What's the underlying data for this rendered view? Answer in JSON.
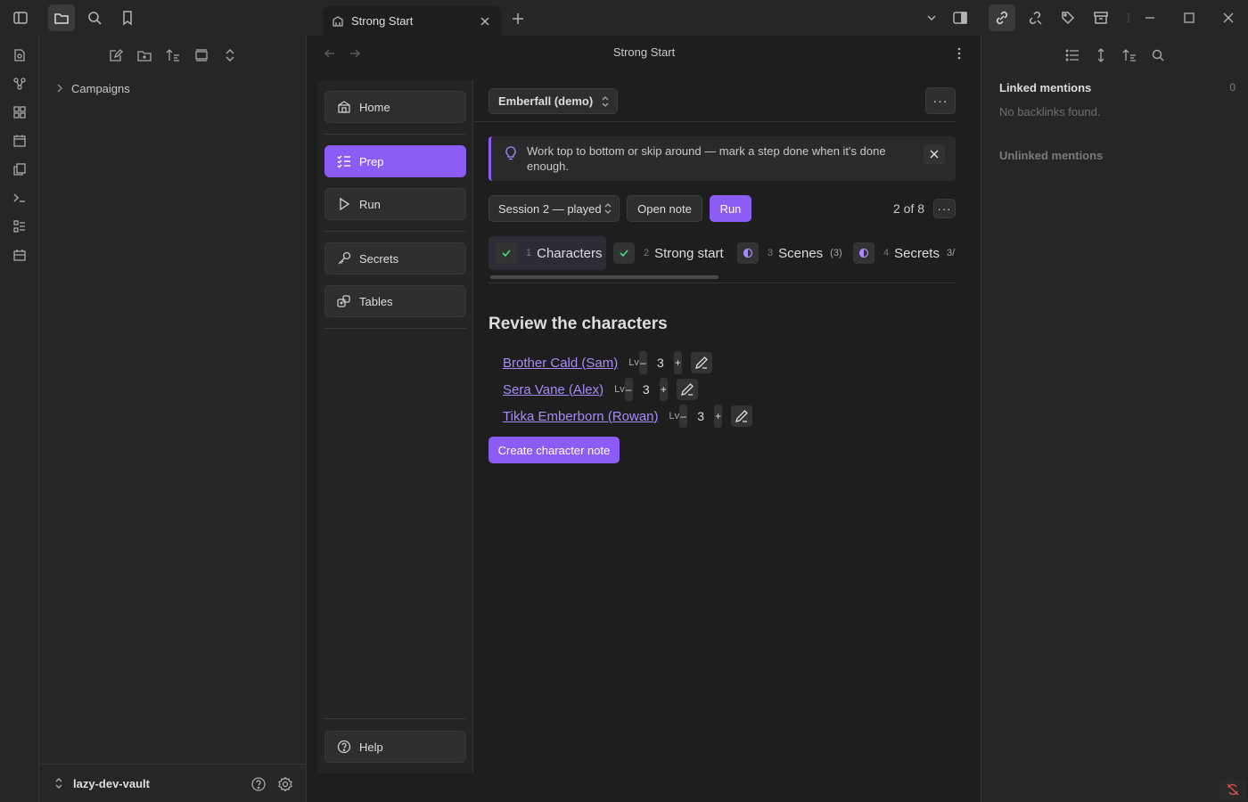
{
  "titlebar": {
    "tab_title": "Strong Start",
    "sep_glyph": "⁞"
  },
  "left_sidebar": {
    "tree": [
      {
        "label": "Campaigns"
      }
    ],
    "vault_name": "lazy-dev-vault"
  },
  "view": {
    "title": "Strong Start"
  },
  "plugin_nav": {
    "items": [
      {
        "label": "Home",
        "icon": "building-icon"
      },
      {
        "label": "Prep",
        "icon": "list-checks-icon",
        "active": true
      },
      {
        "label": "Run",
        "icon": "play-icon"
      },
      {
        "label": "Secrets",
        "icon": "key-icon"
      },
      {
        "label": "Tables",
        "icon": "dice-icon"
      }
    ],
    "help_label": "Help"
  },
  "content": {
    "campaign_select": "Emberfall (demo)",
    "more_glyph": "···",
    "tip": "Work top to bottom or skip around — mark a step done when it's done enough.",
    "session_select": "Session 2 — played",
    "open_note_label": "Open note",
    "run_label": "Run",
    "step_counter": "2 of 8",
    "steps": [
      {
        "num": "1",
        "label": "Characters",
        "status": "done",
        "count": ""
      },
      {
        "num": "2",
        "label": "Strong start",
        "status": "done",
        "count": ""
      },
      {
        "num": "3",
        "label": "Scenes",
        "status": "partial",
        "count": "(3)"
      },
      {
        "num": "4",
        "label": "Secrets",
        "status": "partial",
        "count": "3/"
      }
    ],
    "section_title": "Review the characters",
    "characters": [
      {
        "name": "Brother Cald (Sam)",
        "lv_label": "Lv",
        "level": "3"
      },
      {
        "name": "Sera Vane (Alex)",
        "lv_label": "Lv",
        "level": "3"
      },
      {
        "name": "Tikka Emberborn (Rowan)",
        "lv_label": "Lv",
        "level": "3"
      }
    ],
    "stepper_minus": "–",
    "stepper_plus": "+",
    "create_label": "Create character note"
  },
  "right_sidebar": {
    "linked_title": "Linked mentions",
    "linked_count": "0",
    "no_backlinks": "No backlinks found.",
    "unlinked_title": "Unlinked mentions"
  },
  "colors": {
    "accent": "#8b5cf6",
    "link": "#a78bfa",
    "check": "#4ade80",
    "bg": "#1e1e1e",
    "panel": "#262626"
  }
}
